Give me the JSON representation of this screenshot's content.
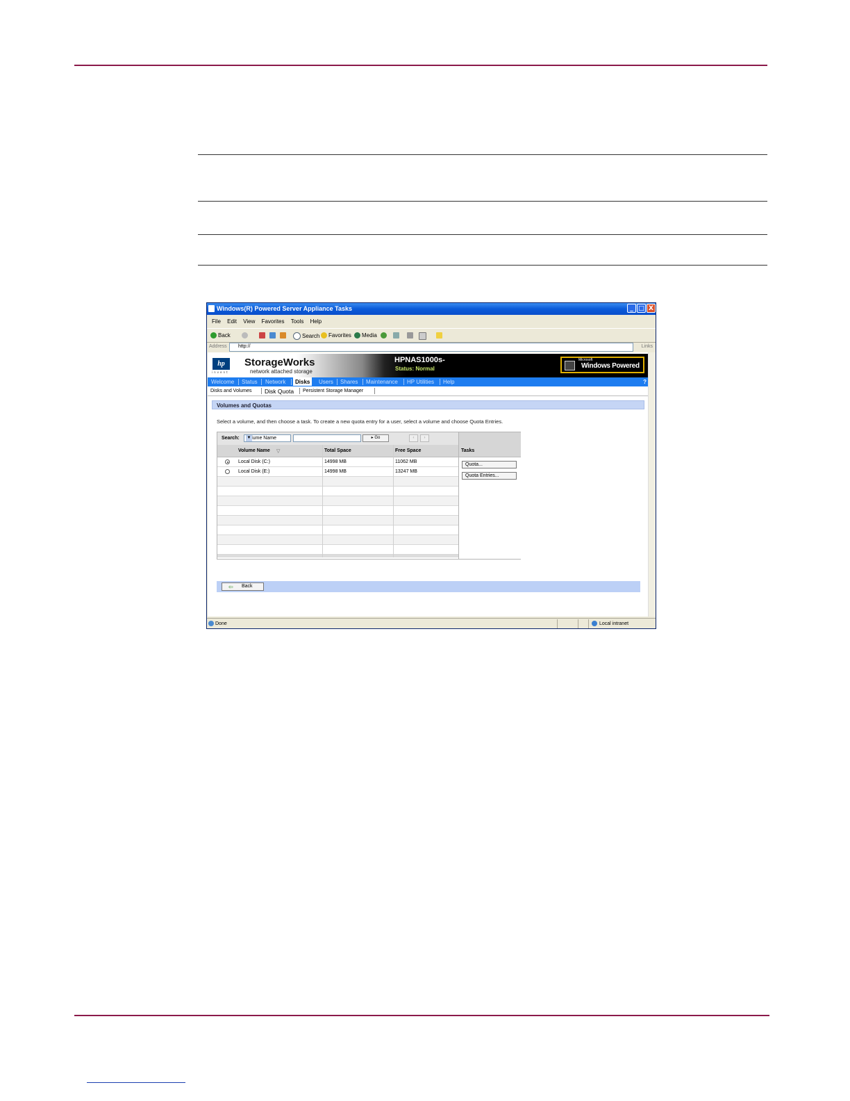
{
  "window": {
    "title": "Windows(R) Powered Server Appliance Tasks",
    "controls": [
      "_",
      "□",
      "X"
    ]
  },
  "menu": [
    "File",
    "Edit",
    "View",
    "Favorites",
    "Tools",
    "Help"
  ],
  "toolbar": {
    "back": "Back",
    "search": "Search",
    "favorites": "Favorites",
    "media": "Media"
  },
  "address": {
    "label": "Address",
    "value": "http://",
    "links": "Links"
  },
  "banner": {
    "logo": "hp",
    "logo_sub": "invent",
    "brand": "StorageWorks",
    "brand_sub": "network attached storage",
    "host": "HPNAS1000s-",
    "status": "Status: Normal",
    "ms_small": "Microsoft",
    "ms_logo": "Windows Powered"
  },
  "nav": {
    "items": [
      "Welcome",
      "Status",
      "Network",
      "Disks",
      "Users",
      "Shares",
      "Maintenance",
      "HP Utilities",
      "Help"
    ],
    "active": "Disks",
    "help_icon": "?"
  },
  "subnav": {
    "items": [
      "Disks and Volumes",
      "Disk Quota",
      "Persistent Storage Manager"
    ],
    "active": "Disk Quota"
  },
  "section": {
    "title": "Volumes and Quotas",
    "instructions": "Select a volume, and then choose a task. To create a new quota entry for a user, select a volume and choose Quota Entries."
  },
  "search": {
    "label": "Search:",
    "field": "Volume Name",
    "value": "",
    "go": "Go"
  },
  "table": {
    "columns": [
      "Volume Name",
      "Total Space",
      "Free Space"
    ],
    "rows": [
      {
        "name": "Local Disk (C:)",
        "total": "14998 MB",
        "free": "11062 MB",
        "selected": true
      },
      {
        "name": "Local Disk (E:)",
        "total": "14998 MB",
        "free": "13247 MB",
        "selected": false
      }
    ]
  },
  "tasks": {
    "header": "Tasks",
    "buttons": [
      "Quota...",
      "Quota Entries..."
    ]
  },
  "footer": {
    "back": "Back"
  },
  "statusbar": {
    "left": "Done",
    "zone": "Local intranet"
  },
  "colors": {
    "rule": "#8b1a4a",
    "nav": "#1e7df0",
    "section": "#c5d5f5"
  }
}
